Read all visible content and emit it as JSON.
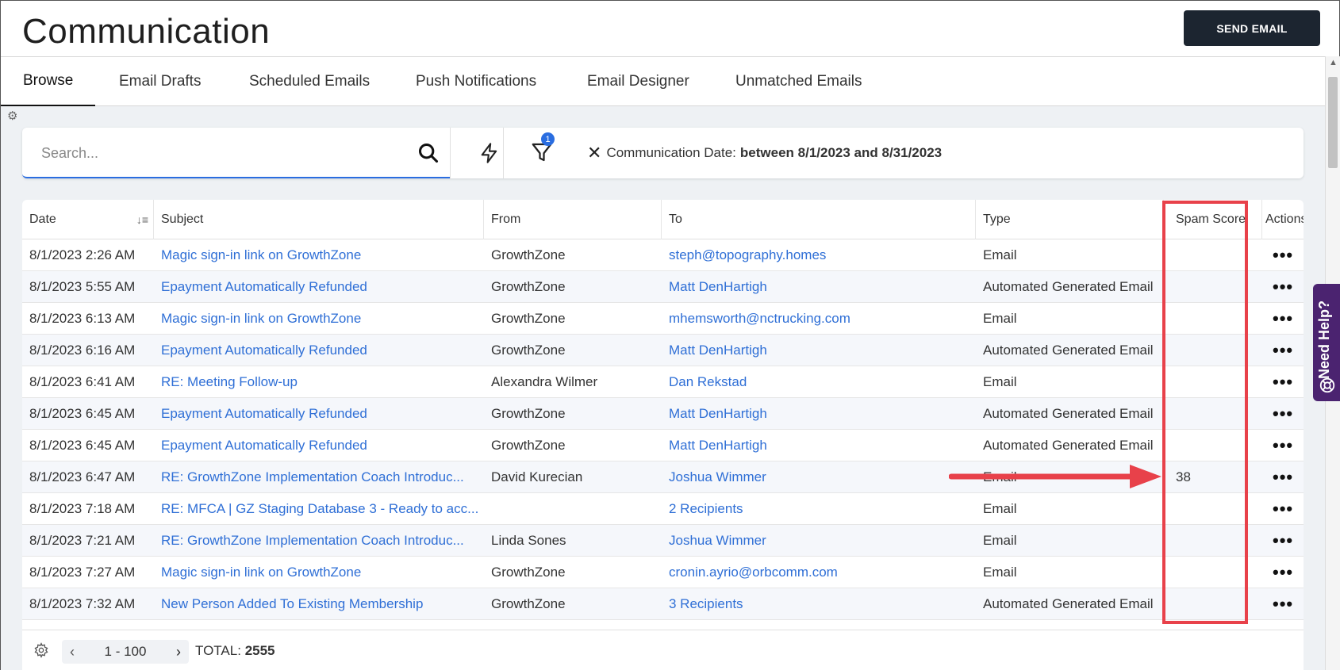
{
  "header": {
    "title": "Communication",
    "send_button": "SEND EMAIL"
  },
  "tabs": [
    {
      "label": "Browse",
      "active": true
    },
    {
      "label": "Email Drafts"
    },
    {
      "label": "Scheduled Emails"
    },
    {
      "label": "Push Notifications"
    },
    {
      "label": "Email Designer"
    },
    {
      "label": "Unmatched Emails"
    }
  ],
  "search": {
    "placeholder": "Search...",
    "value": ""
  },
  "filter": {
    "badge_count": "1",
    "chip_label": "Communication Date:",
    "chip_value": "between 8/1/2023 and 8/31/2023"
  },
  "columns": [
    "Date",
    "Subject",
    "From",
    "To",
    "Type",
    "Spam Score",
    "Actions"
  ],
  "rows": [
    {
      "date": "8/1/2023 2:26 AM",
      "subject": "Magic sign-in link on GrowthZone",
      "from": "GrowthZone",
      "to": "steph@topography.homes",
      "type": "Email",
      "spam": ""
    },
    {
      "date": "8/1/2023 5:55 AM",
      "subject": "Epayment Automatically Refunded",
      "from": "GrowthZone",
      "to": "Matt DenHartigh",
      "type": "Automated Generated Email",
      "spam": ""
    },
    {
      "date": "8/1/2023 6:13 AM",
      "subject": "Magic sign-in link on GrowthZone",
      "from": "GrowthZone",
      "to": "mhemsworth@nctrucking.com",
      "type": "Email",
      "spam": ""
    },
    {
      "date": "8/1/2023 6:16 AM",
      "subject": "Epayment Automatically Refunded",
      "from": "GrowthZone",
      "to": "Matt DenHartigh",
      "type": "Automated Generated Email",
      "spam": ""
    },
    {
      "date": "8/1/2023 6:41 AM",
      "subject": "RE: Meeting Follow-up",
      "from": "Alexandra Wilmer",
      "to": "Dan Rekstad",
      "type": "Email",
      "spam": ""
    },
    {
      "date": "8/1/2023 6:45 AM",
      "subject": "Epayment Automatically Refunded",
      "from": "GrowthZone",
      "to": "Matt DenHartigh",
      "type": "Automated Generated Email",
      "spam": ""
    },
    {
      "date": "8/1/2023 6:45 AM",
      "subject": "Epayment Automatically Refunded",
      "from": "GrowthZone",
      "to": "Matt DenHartigh",
      "type": "Automated Generated Email",
      "spam": ""
    },
    {
      "date": "8/1/2023 6:47 AM",
      "subject": "RE: GrowthZone Implementation Coach Introduc...",
      "from": "David Kurecian",
      "to": "Joshua Wimmer",
      "type": "Email",
      "spam": "38"
    },
    {
      "date": "8/1/2023 7:18 AM",
      "subject": "RE: MFCA | GZ Staging Database 3 - Ready to acc...",
      "from": "",
      "to": "2 Recipients",
      "type": "Email",
      "spam": ""
    },
    {
      "date": "8/1/2023 7:21 AM",
      "subject": "RE: GrowthZone Implementation Coach Introduc...",
      "from": "Linda Sones",
      "to": "Joshua Wimmer",
      "type": "Email",
      "spam": ""
    },
    {
      "date": "8/1/2023 7:27 AM",
      "subject": "Magic sign-in link on GrowthZone",
      "from": "GrowthZone",
      "to": "cronin.ayrio@orbcomm.com",
      "type": "Email",
      "spam": ""
    },
    {
      "date": "8/1/2023 7:32 AM",
      "subject": "New Person Added To Existing Membership",
      "from": "GrowthZone",
      "to": "3 Recipients",
      "type": "Automated Generated Email",
      "spam": ""
    }
  ],
  "footer": {
    "page_range": "1 - 100",
    "total_label": "TOTAL:",
    "total_value": "2555"
  },
  "help": {
    "label": "Need Help?"
  },
  "colors": {
    "link": "#2f6fd6",
    "accent": "#2a6de0",
    "highlight": "#e8414a",
    "help_bg": "#4b2370",
    "button_bg": "#1c2530"
  }
}
